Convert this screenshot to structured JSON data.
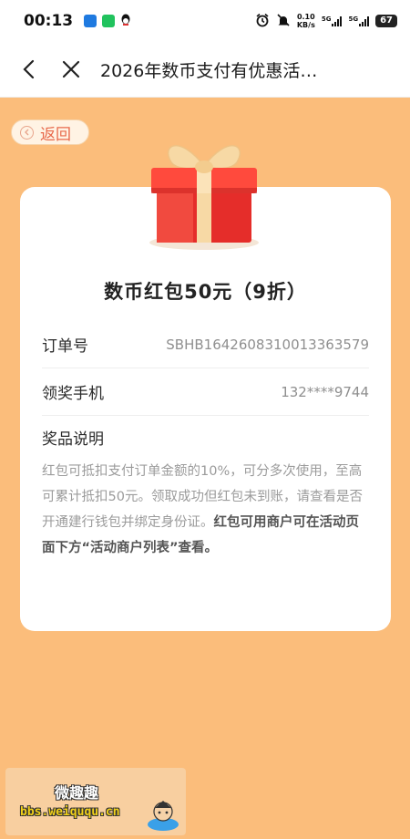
{
  "status_bar": {
    "time": "00:13",
    "net_speed_value": "0.10",
    "net_speed_unit": "KB/s",
    "sim1": "5G",
    "sim2": "5G",
    "battery": "67"
  },
  "nav": {
    "title": "2026年数币支付有优惠活…"
  },
  "back": {
    "label": "返回"
  },
  "card": {
    "prize_title": "数币红包50元（9折）",
    "rows": [
      {
        "key": "订单号",
        "value": "SBHB1642608310013363579"
      },
      {
        "key": "领奖手机",
        "value": "132****9744"
      }
    ],
    "desc_title": "奖品说明",
    "desc_normal": "红包可抵扣支付订单金额的10%，可分多次使用，至高可累计抵扣50元。领取成功但红包未到账，请查看是否开通建行钱包并绑定身份证。",
    "desc_bold": "红包可用商户可在活动页面下方“活动商户列表”查看。"
  },
  "watermark": {
    "name": "微趣趣",
    "url": "bbs.weiququ.cn"
  },
  "colors": {
    "page_bg": "#fbbd7b",
    "accent_red": "#e8694b",
    "gift_red": "#ef3a31",
    "ribbon": "#f7d9a5"
  }
}
